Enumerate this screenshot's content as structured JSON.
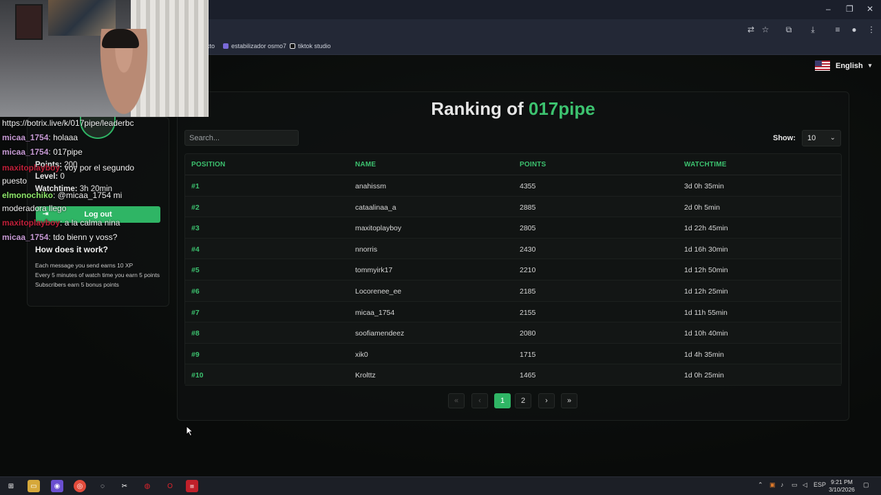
{
  "browser": {
    "bookmarks": [
      {
        "label": "cto"
      },
      {
        "label": "estabilizador osmo7"
      },
      {
        "label": "tiktok studio"
      }
    ],
    "window_controls": {
      "minimize": "–",
      "restore": "❐",
      "close": "✕"
    }
  },
  "language": {
    "label": "English",
    "flag_icon": "us-flag-icon"
  },
  "ranking": {
    "title_prefix": "Ranking of",
    "username": "017pipe",
    "search_placeholder": "Search...",
    "show_label": "Show:",
    "show_value": "10",
    "columns": [
      "POSITION",
      "NAME",
      "POINTS",
      "WATCHTIME"
    ],
    "rows": [
      {
        "position": "#1",
        "name": "anahissm",
        "points": "4355",
        "watchtime": "3d 0h 35min"
      },
      {
        "position": "#2",
        "name": "cataalinaa_a",
        "points": "2885",
        "watchtime": "2d 0h 5min"
      },
      {
        "position": "#3",
        "name": "maxitoplayboy",
        "points": "2805",
        "watchtime": "1d 22h 45min"
      },
      {
        "position": "#4",
        "name": "nnorris",
        "points": "2430",
        "watchtime": "1d 16h 30min"
      },
      {
        "position": "#5",
        "name": "tommyirk17",
        "points": "2210",
        "watchtime": "1d 12h 50min"
      },
      {
        "position": "#6",
        "name": "Locorenee_ee",
        "points": "2185",
        "watchtime": "1d 12h 25min"
      },
      {
        "position": "#7",
        "name": "micaa_1754",
        "points": "2155",
        "watchtime": "1d 11h 55min"
      },
      {
        "position": "#8",
        "name": "soofiamendeez",
        "points": "2080",
        "watchtime": "1d 10h 40min"
      },
      {
        "position": "#9",
        "name": "xik0",
        "points": "1715",
        "watchtime": "1d 4h 35min"
      },
      {
        "position": "#10",
        "name": "Krolttz",
        "points": "1465",
        "watchtime": "1d 0h 25min"
      }
    ],
    "pagination": {
      "first": "«",
      "prev": "‹",
      "pages": [
        "1",
        "2"
      ],
      "current": "1",
      "next": "›",
      "last": "»"
    }
  },
  "profile": {
    "points_label": "Points:",
    "points_value": "200",
    "level_label": "Level:",
    "level_value": "0",
    "watchtime_label": "Watchtime:",
    "watchtime_value": "3h 20min",
    "logout_label": "Log out",
    "how_title": "How does it work?",
    "rules": [
      "Each message you send earns 10 XP",
      "Every 5 minutes of watch time you earn 5 points",
      "Subscribers earn 5 bonus points"
    ]
  },
  "chat_overlay": [
    {
      "user": "",
      "text": "https://botrix.live/k/017pipe/leaderbc"
    },
    {
      "user": "micaa_1754",
      "text": ": holaaa"
    },
    {
      "user": "micaa_1754",
      "text": ": 017pipe"
    },
    {
      "user": "maxitoplayboy",
      "text": ": voy por el segundo"
    },
    {
      "user": "",
      "text": "puesto"
    },
    {
      "user": "elmonochiko",
      "text": ": @micaa_1754 mi"
    },
    {
      "user": "",
      "text": "moderadora llego"
    },
    {
      "user": "maxitoplayboy",
      "text": ": a la calma nina"
    },
    {
      "user": "micaa_1754",
      "text": ": tdo bienn y voss?"
    }
  ],
  "taskbar": {
    "tray_lang": "ESP",
    "time": "9:21 PM",
    "date": "3/10/2026"
  },
  "colors": {
    "accent": "#2fb565",
    "accent_text": "#3cc26f",
    "background": "#0b0d0c"
  }
}
